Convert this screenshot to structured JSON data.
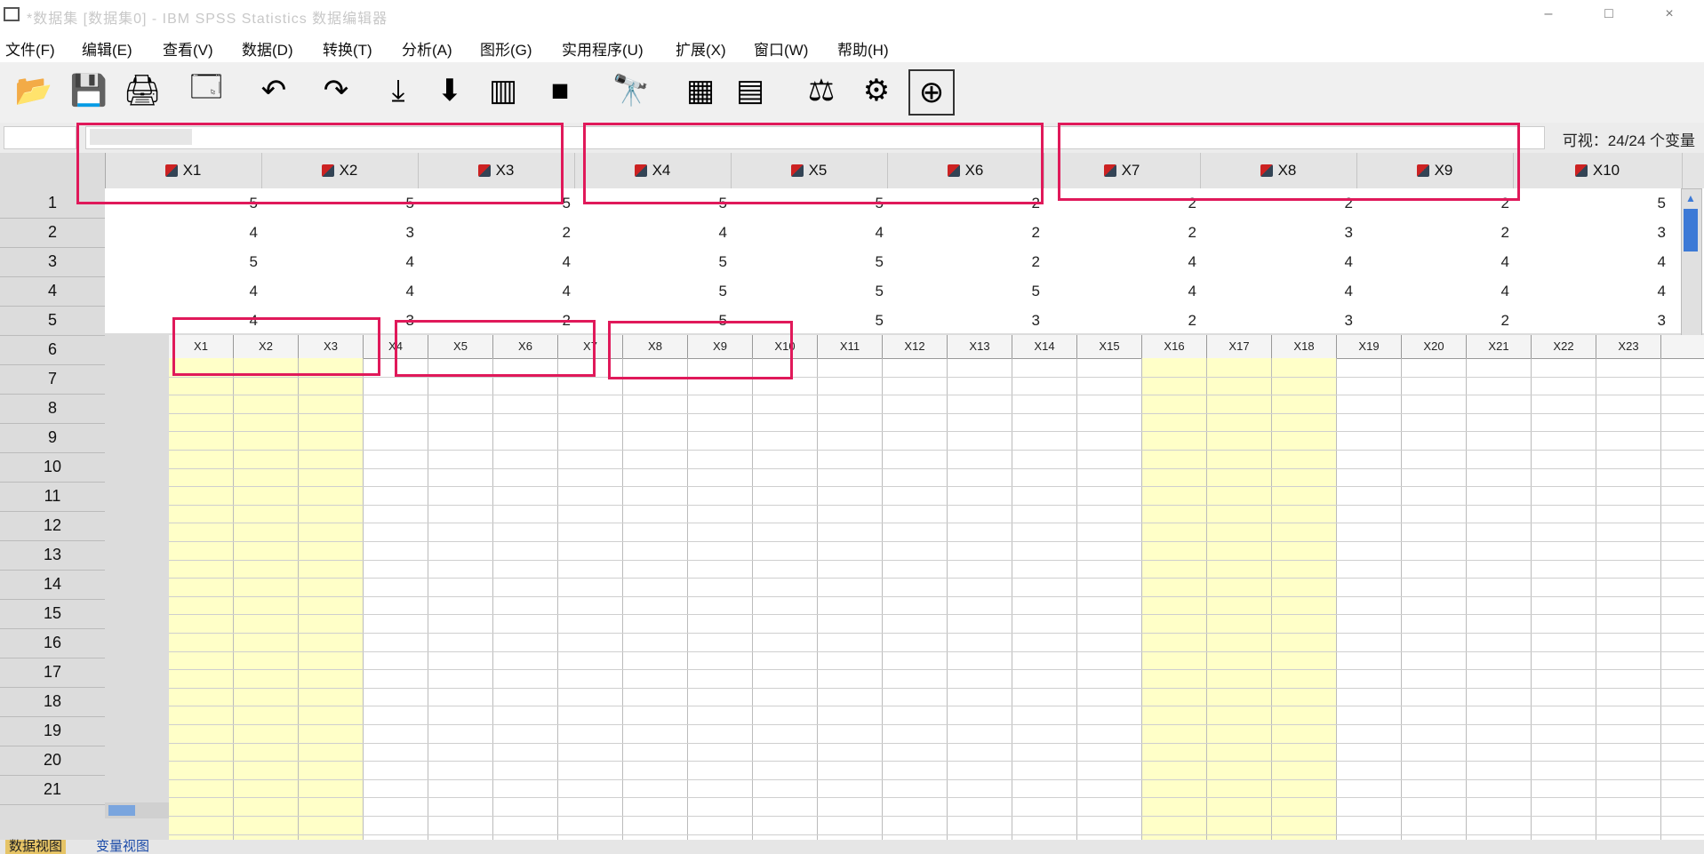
{
  "window": {
    "title": "*数据集 [数据集0] - IBM SPSS Statistics 数据编辑器",
    "minimize": "–",
    "maximize": "□",
    "close": "×"
  },
  "menu": [
    "文件(F)",
    "编辑(E)",
    "查看(V)",
    "数据(D)",
    "转换(T)",
    "分析(A)",
    "图形(G)",
    "实用程序(U)",
    "扩展(X)",
    "窗口(W)",
    "帮助(H)"
  ],
  "toolbar": {
    "icons": [
      "open-icon",
      "save-icon",
      "print-icon",
      "recall-dialog-icon",
      "undo-icon",
      "redo-icon",
      "goto-case-icon",
      "goto-variable-icon",
      "variables-icon",
      "run-icon",
      "find-icon",
      "insert-cases-icon",
      "insert-variable-icon",
      "split-file-icon",
      "weight-cases-icon",
      "select-cases-icon",
      "value-labels-icon"
    ]
  },
  "cell_editor": {
    "ref": "",
    "value": ""
  },
  "visible_vars": "可视：24/24 个变量",
  "variables": [
    "X1",
    "X2",
    "X3",
    "X4",
    "X5",
    "X6",
    "X7",
    "X8",
    "X9",
    "X10"
  ],
  "rows": [
    "1",
    "2",
    "3",
    "4",
    "5",
    "6",
    "7",
    "8",
    "9",
    "10",
    "11",
    "12",
    "13",
    "14",
    "15",
    "16",
    "17",
    "18",
    "19",
    "20",
    "21"
  ],
  "grid_values": [
    [
      "5",
      "5",
      "5",
      "5",
      "5",
      "2",
      "2",
      "2",
      "2",
      "5"
    ],
    [
      "4",
      "3",
      "2",
      "4",
      "4",
      "2",
      "2",
      "3",
      "2",
      "3"
    ],
    [
      "5",
      "4",
      "4",
      "5",
      "5",
      "2",
      "4",
      "4",
      "4",
      "4"
    ],
    [
      "4",
      "4",
      "4",
      "5",
      "5",
      "5",
      "4",
      "4",
      "4",
      "4"
    ],
    [
      "4",
      "3",
      "2",
      "5",
      "5",
      "3",
      "2",
      "3",
      "2",
      "3"
    ]
  ],
  "overlay": {
    "headers": [
      "X1",
      "X2",
      "X3",
      "X4",
      "X5",
      "X6",
      "X7",
      "X8",
      "X9",
      "X10",
      "X11",
      "X12",
      "X13",
      "X14",
      "X15",
      "X16",
      "X17",
      "X18",
      "X19",
      "X20",
      "X21",
      "X22",
      "X23"
    ],
    "highlight_cols": [
      0,
      1,
      2,
      15,
      16,
      17
    ],
    "row_count": 26
  },
  "tabs": {
    "data_view": "数据视图",
    "variable_view": "变量视图"
  },
  "colors": {
    "highlight_box": "#e0195a",
    "yellow_fill": "#ffffc8",
    "active_tab": "#e6c466"
  }
}
